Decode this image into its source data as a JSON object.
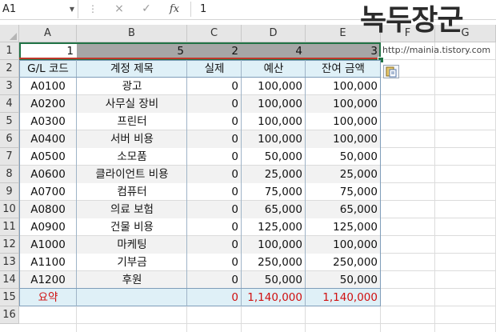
{
  "formula_bar": {
    "name_box": "A1",
    "cancel_icon": "×",
    "enter_icon": "✓",
    "function_icon": "fx",
    "formula_value": "1"
  },
  "watermark": {
    "title": "녹두장군",
    "url": "http://mainia.tistory.com"
  },
  "columns": [
    "A",
    "B",
    "C",
    "D",
    "E",
    "F",
    "G"
  ],
  "rows": [
    "1",
    "2",
    "3",
    "4",
    "5",
    "6",
    "7",
    "8",
    "9",
    "10",
    "11",
    "12",
    "13",
    "14",
    "15",
    "16"
  ],
  "row1": [
    "1",
    "5",
    "2",
    "4",
    "3"
  ],
  "headers": [
    "G/L 코드",
    "계정 제목",
    "실제",
    "예산",
    "잔여 금액"
  ],
  "table": [
    [
      "A0100",
      "광고",
      "0",
      "100,000",
      "100,000"
    ],
    [
      "A0200",
      "사무실 장비",
      "0",
      "100,000",
      "100,000"
    ],
    [
      "A0300",
      "프린터",
      "0",
      "100,000",
      "100,000"
    ],
    [
      "A0400",
      "서버 비용",
      "0",
      "100,000",
      "100,000"
    ],
    [
      "A0500",
      "소모품",
      "0",
      "50,000",
      "50,000"
    ],
    [
      "A0600",
      "클라이언트 비용",
      "0",
      "25,000",
      "25,000"
    ],
    [
      "A0700",
      "컴퓨터",
      "0",
      "75,000",
      "75,000"
    ],
    [
      "A0800",
      "의료 보험",
      "0",
      "65,000",
      "65,000"
    ],
    [
      "A0900",
      "건물 비용",
      "0",
      "125,000",
      "125,000"
    ],
    [
      "A1000",
      "마케팅",
      "0",
      "100,000",
      "100,000"
    ],
    [
      "A1100",
      "기부금",
      "0",
      "250,000",
      "250,000"
    ],
    [
      "A1200",
      "후원",
      "0",
      "50,000",
      "50,000"
    ]
  ],
  "summary": [
    "요약",
    "",
    "0",
    "1,140,000",
    "1,140,000"
  ],
  "colors": {
    "accent_green": "#217346",
    "summary_red": "#d01010",
    "header_fill": "#dff0f7",
    "row1_fill": "#a6a6a6"
  }
}
